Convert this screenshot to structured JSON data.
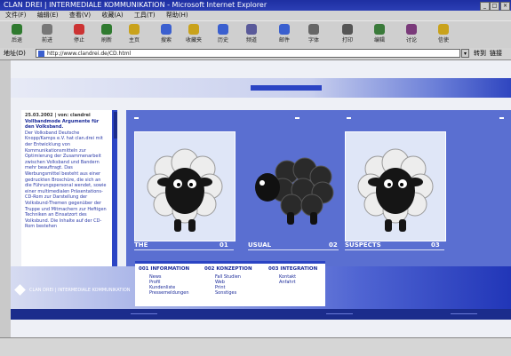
{
  "window": {
    "title": "CLAN DREI | INTERMEDIALE KOMMUNIKATION - Microsoft Internet Explorer",
    "controls": [
      "_",
      "□",
      "×"
    ]
  },
  "menu": [
    "文件(F)",
    "编辑(E)",
    "查看(V)",
    "收藏(A)",
    "工具(T)",
    "帮助(H)"
  ],
  "toolbar": {
    "buttons": [
      {
        "label": "后退",
        "icon": "back-arrow-icon"
      },
      {
        "label": "前进",
        "icon": "forward-arrow-icon"
      },
      {
        "label": "停止",
        "icon": "stop-icon"
      },
      {
        "label": "刷新",
        "icon": "refresh-icon"
      },
      {
        "label": "主页",
        "icon": "home-icon"
      },
      {
        "label": "搜索",
        "icon": "search-icon"
      },
      {
        "label": "收藏夹",
        "icon": "favorites-icon"
      },
      {
        "label": "历史",
        "icon": "history-icon"
      },
      {
        "label": "频道",
        "icon": "channels-icon"
      },
      {
        "label": "邮件",
        "icon": "mail-icon"
      },
      {
        "label": "字体",
        "icon": "font-icon"
      },
      {
        "label": "打印",
        "icon": "print-icon"
      },
      {
        "label": "编辑",
        "icon": "edit-icon"
      },
      {
        "label": "讨论",
        "icon": "discuss-icon"
      },
      {
        "label": "信使",
        "icon": "messenger-icon"
      }
    ]
  },
  "address": {
    "label": "地址(D)",
    "url": "http://www.clandrei.de/CD.html",
    "go": "转到",
    "links": "链接"
  },
  "site": {
    "news": {
      "date": "25.03.2002 | von: clandrei",
      "headline": "Vollbandmode Argumente für den Volksband.",
      "body": "Der Volksband Deutsche Knopp/Kamps e.V. hat clan.drei mit der Entwicklung von Kommunikationsmitteln zur Optimierung der Zusammenarbeit zwischen Volksband und Bandern mehr beauftragt. Das Werbungsmittel besteht aus einer gedruckten Broschüre, die sich an die Führungspersonal wendet, sowie einer multimedialen Präsentations-CD-Rom zur Darstellung der Volksbund-Themen gegenüber der Truppe und Mitmachern zur Heftigen Techniken an Einsatzort des Volksbund. Die Inhalte auf der CD-Rom bestehen"
    },
    "gallery": {
      "captions": [
        "THE",
        "USUAL",
        "SUSPECTS"
      ],
      "numbers": [
        "01",
        "02",
        "03"
      ]
    },
    "logo_text": "CLAN DREI | INTERMEDIALE KOMMUNIKATION",
    "nav": [
      {
        "heading": "001 INFORMATION",
        "items": [
          "News",
          "Profil",
          "Kundenliste",
          "Pressemeldungen"
        ]
      },
      {
        "heading": "002 KONZEPTION",
        "items": [
          "Fall Studien",
          "Web",
          "Print",
          "Sonstiges"
        ]
      },
      {
        "heading": "003 INTEGRATION",
        "items": [
          "Kontakt",
          "Anfahrt"
        ]
      }
    ]
  },
  "colors": {
    "accent": "#2b44c4",
    "panel": "#5a6fd1",
    "sheep_body": "#e6e6e6",
    "sheep_face": "#111111"
  }
}
